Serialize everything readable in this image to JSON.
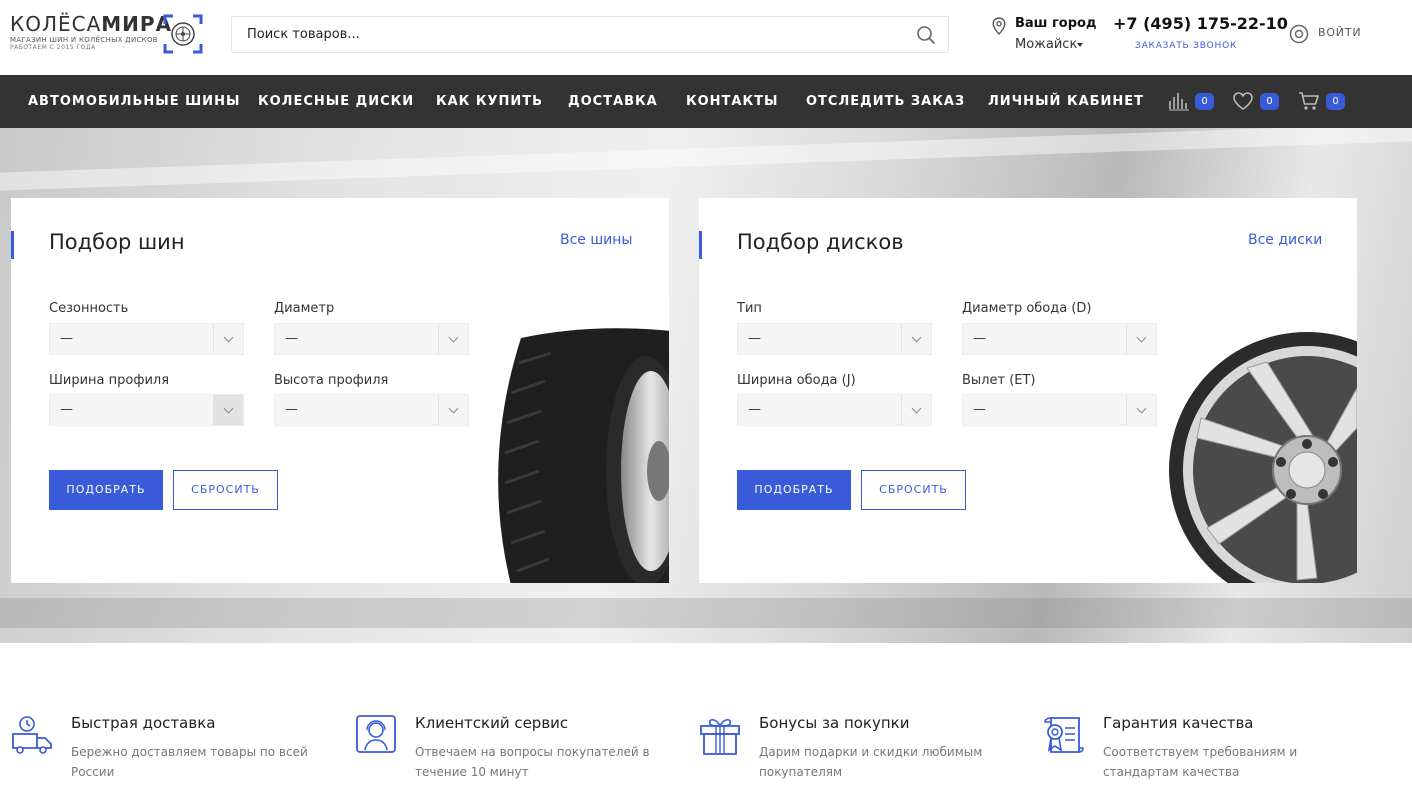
{
  "logo": {
    "name_light": "КОЛЁСА",
    "name_bold": "МИРА",
    "tagline": "МАГАЗИН ШИН И КОЛЁСНЫХ ДИСКОВ",
    "since": "РАБОТАЕМ С 2015 ГОДА"
  },
  "search": {
    "placeholder": "Поиск товаров..."
  },
  "city": {
    "label": "Ваш город",
    "name": "Можайск"
  },
  "phone": {
    "number": "+7 (495) 175-22-10",
    "callback": "ЗАКАЗАТЬ ЗВОНОК"
  },
  "account": {
    "login": "ВОЙТИ"
  },
  "nav": {
    "items": [
      {
        "label": "АВТОМОБИЛЬНЫЕ ШИНЫ"
      },
      {
        "label": "КОЛЕСНЫЕ ДИСКИ"
      },
      {
        "label": "КАК КУПИТЬ"
      },
      {
        "label": "ДОСТАВКА"
      },
      {
        "label": "КОНТАКТЫ"
      },
      {
        "label": "ОТСЛЕДИТЬ ЗАКАЗ"
      },
      {
        "label": "ЛИЧНЫЙ КАБИНЕТ"
      }
    ],
    "compare_count": "0",
    "favorites_count": "0",
    "cart_count": "0"
  },
  "tires": {
    "title": "Подбор шин",
    "all_link": "Все шины",
    "fields": [
      {
        "label": "Сезонность",
        "value": "—"
      },
      {
        "label": "Диаметр",
        "value": "—"
      },
      {
        "label": "Ширина профиля",
        "value": "—"
      },
      {
        "label": "Высота профиля",
        "value": "—"
      }
    ],
    "submit": "ПОДОБРАТЬ",
    "reset": "СБРОСИТЬ"
  },
  "wheels": {
    "title": "Подбор дисков",
    "all_link": "Все диски",
    "fields": [
      {
        "label": "Тип",
        "value": "—"
      },
      {
        "label": "Диаметр обода (D)",
        "value": "—"
      },
      {
        "label": "Ширина обода (J)",
        "value": "—"
      },
      {
        "label": "Вылет (ET)",
        "value": "—"
      }
    ],
    "submit": "ПОДОБРАТЬ",
    "reset": "СБРОСИТЬ"
  },
  "features": [
    {
      "title": "Быстрая доставка",
      "text": "Бережно доставляем товары по всей России",
      "icon": "delivery-truck-icon"
    },
    {
      "title": "Клиентский сервис",
      "text": "Отвечаем на вопросы покупателей в течение 10 минут",
      "icon": "support-agent-icon"
    },
    {
      "title": "Бонусы за покупки",
      "text": "Дарим подарки и скидки любимым покупателям",
      "icon": "gift-icon"
    },
    {
      "title": "Гарантия качества",
      "text": "Соответствуем требованиям и стандартам качества",
      "icon": "certificate-icon"
    }
  ],
  "colors": {
    "accent": "#3a5bd9",
    "nav_bg": "#333333"
  }
}
